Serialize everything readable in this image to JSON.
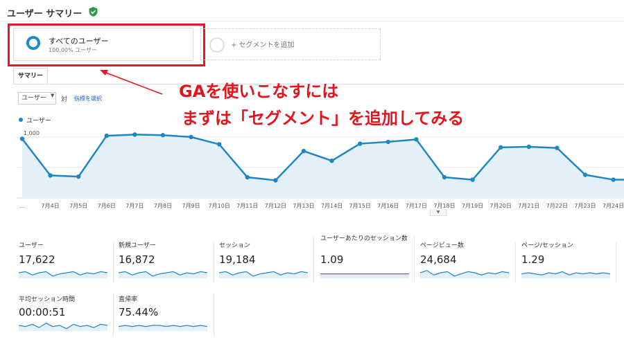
{
  "header": {
    "title": "ユーザー サマリー",
    "status_icon": "verified-shield-icon"
  },
  "segments": {
    "active": {
      "name": "すべてのユーザー",
      "detail": "100.00% ユーザー"
    },
    "add_label": "+ セグメントを追加"
  },
  "tabs": {
    "summary": "サマリー"
  },
  "controls": {
    "metric": "ユーザー",
    "vs": "対",
    "choose_metric": "指標を選択"
  },
  "callout": {
    "line1": "GAを使いこなすには",
    "line2": "まずは「セグメント」を追加してみる"
  },
  "colors": {
    "accent": "#1f86c4",
    "area_fill": "#e3f0f8",
    "highlight_red": "#e8141e"
  },
  "chart_data": {
    "type": "area",
    "series": [
      {
        "name": "ユーザー",
        "values": [
          970,
          370,
          350,
          1020,
          1040,
          1030,
          1000,
          880,
          340,
          290,
          770,
          610,
          890,
          920,
          960,
          340,
          300,
          830,
          840,
          820,
          380,
          300,
          300
        ]
      }
    ],
    "x": [
      "…",
      "7月4日",
      "7月5日",
      "7月6日",
      "7月7日",
      "7月8日",
      "7月9日",
      "7月10日",
      "7月11日",
      "7月12日",
      "7月13日",
      "7月14日",
      "7月15日",
      "7月16日",
      "7月17日",
      "7月18日",
      "7月19日",
      "7月20日",
      "7月21日",
      "7月22日",
      "7月23日",
      "7月24日",
      ""
    ],
    "y_ticks": [
      "1,000",
      "500"
    ],
    "ylim": [
      0,
      1180
    ],
    "grid": true,
    "legend": "top-left"
  },
  "metrics": [
    {
      "label": "ユーザー",
      "value": "17,622"
    },
    {
      "label": "新規ユーザー",
      "value": "16,872"
    },
    {
      "label": "セッション",
      "value": "19,184"
    },
    {
      "label": "ユーザーあたりのセッション数",
      "value": "1.09"
    },
    {
      "label": "ページビュー数",
      "value": "24,684"
    },
    {
      "label": "ページ/セッション",
      "value": "1.29"
    },
    {
      "label": "平均セッション時間",
      "value": "00:00:51"
    },
    {
      "label": "直帰率",
      "value": "75.44%"
    }
  ]
}
